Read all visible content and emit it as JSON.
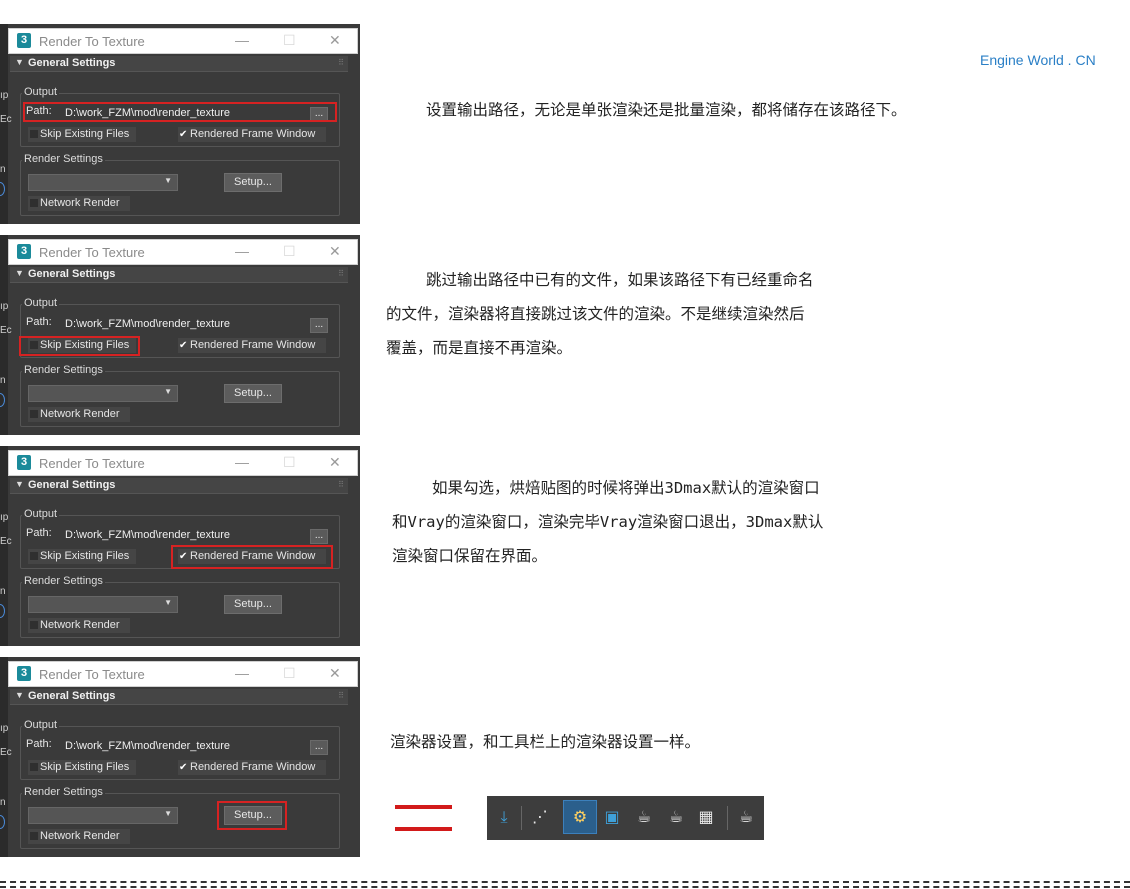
{
  "brand": "Engine World . CN",
  "dialog": {
    "title": "Render To Texture",
    "rollout": "General Settings",
    "output_label": "Output",
    "path_label": "Path:",
    "path_value": "D:\\work_FZM\\mod\\render_texture",
    "browse_label": "...",
    "skip_label": "Skip Existing Files",
    "rendered_frame_label": "Rendered Frame Window",
    "render_settings_label": "Render Settings",
    "setup_label": "Setup...",
    "network_render_label": "Network Render",
    "app_icon": "3",
    "left_strip_1": "ıp",
    "left_strip_2": "Ec",
    "left_strip_3": "n"
  },
  "descriptions": [
    [
      "设置输出路径，无论是单张渲染还是批量渲染，都将储存在该路径下。"
    ],
    [
      "跳过输出路径中已有的文件，如果该路径下有已经重命名",
      "的文件，渲染器将直接跳过该文件的渲染。不是继续渲染然后",
      "覆盖，而是直接不再渲染。"
    ],
    [
      "如果勾选，烘焙贴图的时候将弹出3Dmax默认的渲染窗口",
      "和Vray的渲染窗口，渲染完毕Vray渲染窗口退出，3Dmax默认",
      "渲染窗口保留在界面。"
    ],
    [
      "渲染器设置，和工具栏上的渲染器设置一样。"
    ]
  ],
  "toolbar_icons": [
    "render-setup-download-icon",
    "schematic-icon",
    "render-setup-icon",
    "rendered-frame-window-icon",
    "render-production-icon",
    "render-iterative-icon",
    "render-grid-icon",
    "teapot-render-icon"
  ],
  "colors": {
    "highlight": "#d62222",
    "brand": "#2a7fc6",
    "panel_bg": "#3a3a3a"
  }
}
